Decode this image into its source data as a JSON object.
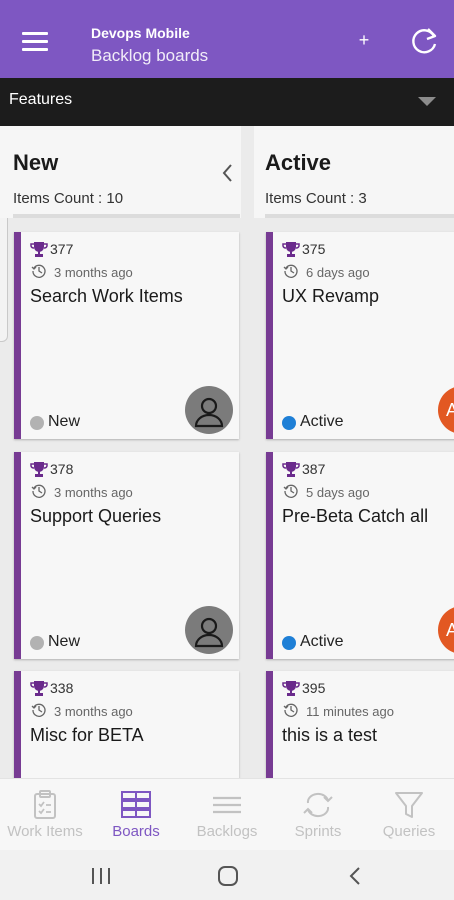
{
  "app": {
    "title": "Devops Mobile",
    "subtitle": "Backlog boards",
    "add_label": "+"
  },
  "filter": {
    "selected": "Features"
  },
  "columns": [
    {
      "title": "New",
      "count_text": "Items Count : 10",
      "cards": [
        {
          "id": "377",
          "time": "3 months ago",
          "title": "Search Work Items",
          "state": "New",
          "state_color": "#b2b2b2"
        },
        {
          "id": "378",
          "time": "3 months ago",
          "title": "Support Queries",
          "state": "New",
          "state_color": "#b2b2b2"
        },
        {
          "id": "338",
          "time": "3 months ago",
          "title": "Misc for BETA",
          "state": "",
          "state_color": "#b2b2b2"
        }
      ]
    },
    {
      "title": "Active",
      "count_text": "Items Count : 3",
      "cards": [
        {
          "id": "375",
          "time": "6 days ago",
          "title": "UX Revamp",
          "state": "Active",
          "state_color": "#1e7fd6",
          "avatar_initial": "A"
        },
        {
          "id": "387",
          "time": "5 days ago",
          "title": "Pre-Beta Catch all",
          "state": "Active",
          "state_color": "#1e7fd6",
          "avatar_initial": "A"
        },
        {
          "id": "395",
          "time": "11 minutes ago",
          "title": "this is a test",
          "state": "",
          "state_color": "#1e7fd6"
        }
      ]
    }
  ],
  "nav": {
    "items": [
      {
        "label": "Work Items",
        "icon": "clipboard-icon"
      },
      {
        "label": "Boards",
        "icon": "boards-icon"
      },
      {
        "label": "Backlogs",
        "icon": "backlog-lines-icon"
      },
      {
        "label": "Sprints",
        "icon": "sprint-cycle-icon"
      },
      {
        "label": "Queries",
        "icon": "funnel-icon"
      }
    ],
    "active": "Boards"
  },
  "colors": {
    "accent": "#7e57c2",
    "card_bar": "#773b93",
    "filter_bg": "#1c1c1c",
    "trophy": "#6a2a8c"
  }
}
